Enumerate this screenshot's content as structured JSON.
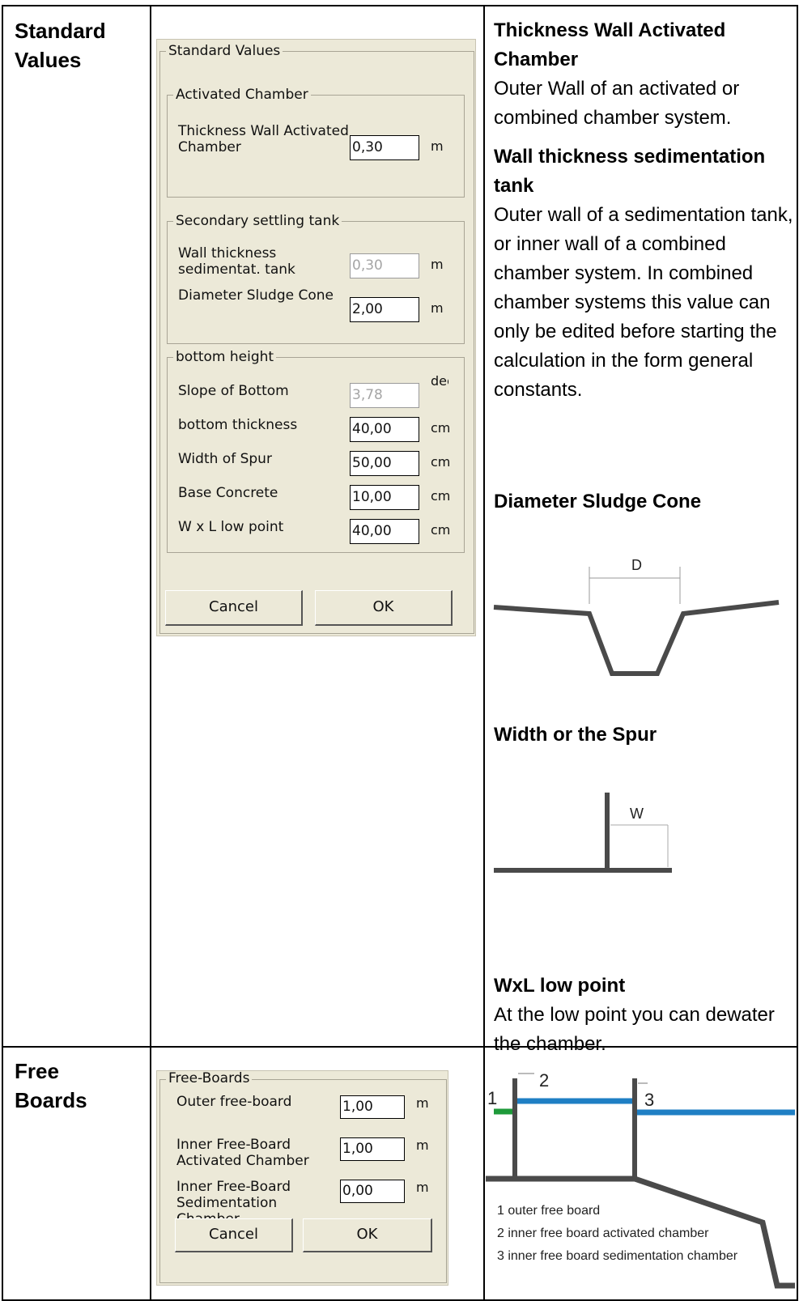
{
  "rows": [
    {
      "header": "Standard Values"
    },
    {
      "header": "Free Boards"
    }
  ],
  "dialog1": {
    "group_title": "Standard Values",
    "activated": {
      "title": "Activated Chamber",
      "thickness_label": "Thickness Wall Activated Chamber",
      "thickness_value": "0,30",
      "thickness_unit": "m"
    },
    "secondary": {
      "title": "Secondary settling tank",
      "wall_label": "Wall thickness sedimentat. tank",
      "wall_value": "0,30",
      "wall_unit": "m",
      "cone_label": "Diameter Sludge Cone",
      "cone_value": "2,00",
      "cone_unit": "m"
    },
    "bottom": {
      "title": "bottom height",
      "slope_label": "Slope of Bottom",
      "slope_value": "3,78",
      "slope_unit": "deç",
      "thickness_label": "bottom thickness",
      "thickness_value": "40,00",
      "thickness_unit": "cm",
      "spur_label": "Width of Spur",
      "spur_value": "50,00",
      "spur_unit": "cm",
      "base_label": "Base Concrete",
      "base_value": "10,00",
      "base_unit": "cm",
      "low_label": "W x L low point",
      "low_value": "40,00",
      "low_unit": "cm"
    },
    "cancel": "Cancel",
    "ok": "OK"
  },
  "doc": {
    "h1": "Thickness Wall Activated Chamber",
    "p1": "Outer Wall of an activated or combined chamber system.",
    "h2": "Wall thickness sedimentation tank",
    "p2": "Outer wall of a sedimentation tank, or inner wall of a combined chamber system. In combined chamber systems this value can only be edited before starting the calculation in the form general constants.",
    "h3": "Diameter Sludge Cone",
    "d_label": "D",
    "h4": "Width or the Spur",
    "w_label": "W",
    "h5": "WxL low point",
    "p5": "At the low point you can dewater the chamber."
  },
  "dialog2": {
    "group_title": "Free-Boards",
    "outer_label": "Outer free-board",
    "outer_value": "1,00",
    "outer_unit": "m",
    "inner_act_label": "Inner Free-Board Activated Chamber",
    "inner_act_value": "1,00",
    "inner_act_unit": "m",
    "inner_sed_label": "Inner Free-Board Sedimentation Chamber",
    "inner_sed_value": "0,00",
    "inner_sed_unit": "m",
    "cancel": "Cancel",
    "ok": "OK"
  },
  "freeboard_figure": {
    "n1": "1",
    "n2": "2",
    "n3": "3",
    "legend1": "1 outer free board",
    "legend2": "2 inner free board activated chamber",
    "legend3": "3 inner free board sedimentation chamber",
    "green": "#1e9a3a",
    "blue": "#1f7fc4",
    "wall": "#4a4a4a"
  }
}
